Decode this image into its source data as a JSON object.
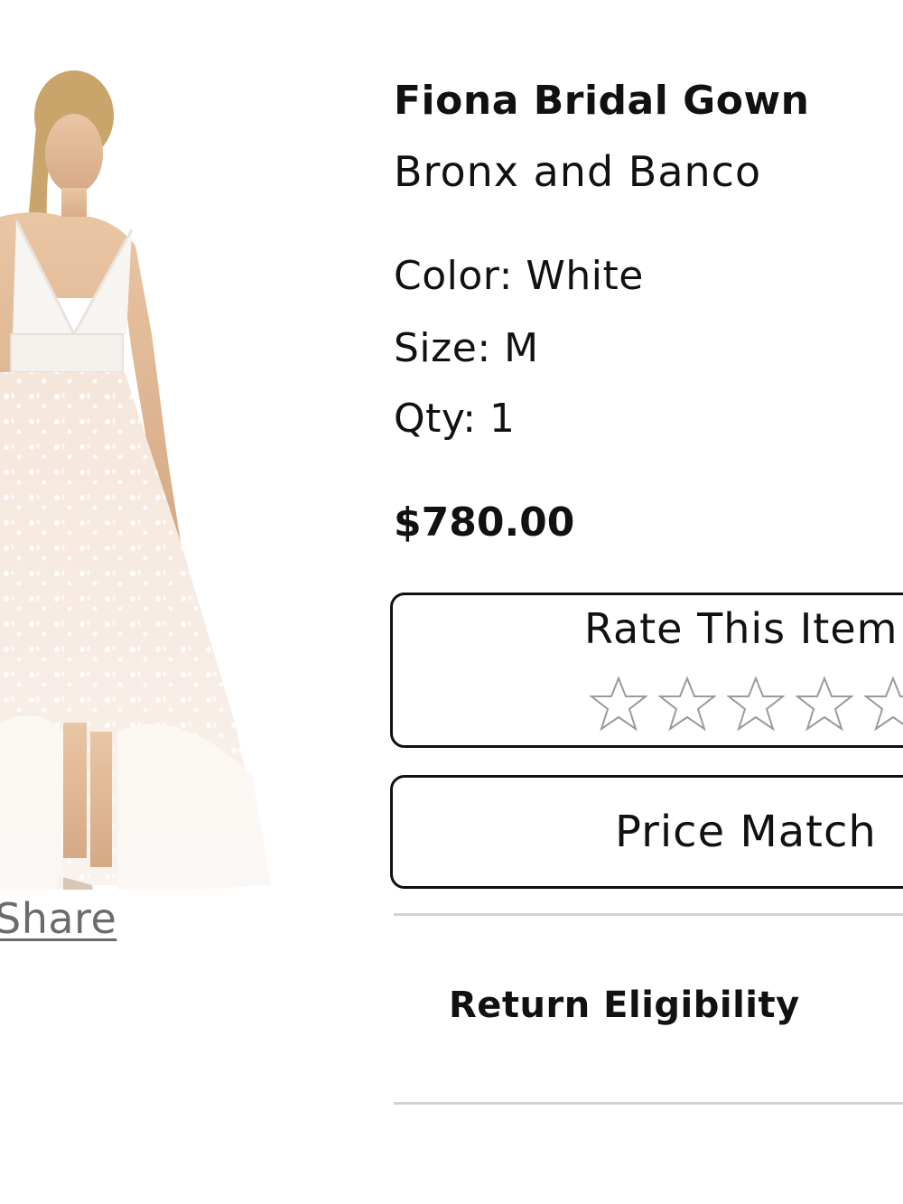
{
  "product": {
    "name": "Fiona Bridal Gown",
    "brand": "Bronx and Banco",
    "color": "Color: White",
    "size": "Size: M",
    "qty": "Qty: 1",
    "price": "$780.00"
  },
  "share": {
    "label": "Share"
  },
  "rating": {
    "title": "Rate This Item",
    "stars_total": 5,
    "stars_selected": 0
  },
  "price_match": {
    "label": "Price Match"
  },
  "return_eligibility": {
    "label": "Return Eligibility"
  },
  "colors": {
    "text": "#111111",
    "share_link": "#6b6b6b",
    "star_outline": "#9a9a9a",
    "divider": "#d2d2d2"
  },
  "icons": {
    "star": "star-outline-icon"
  }
}
